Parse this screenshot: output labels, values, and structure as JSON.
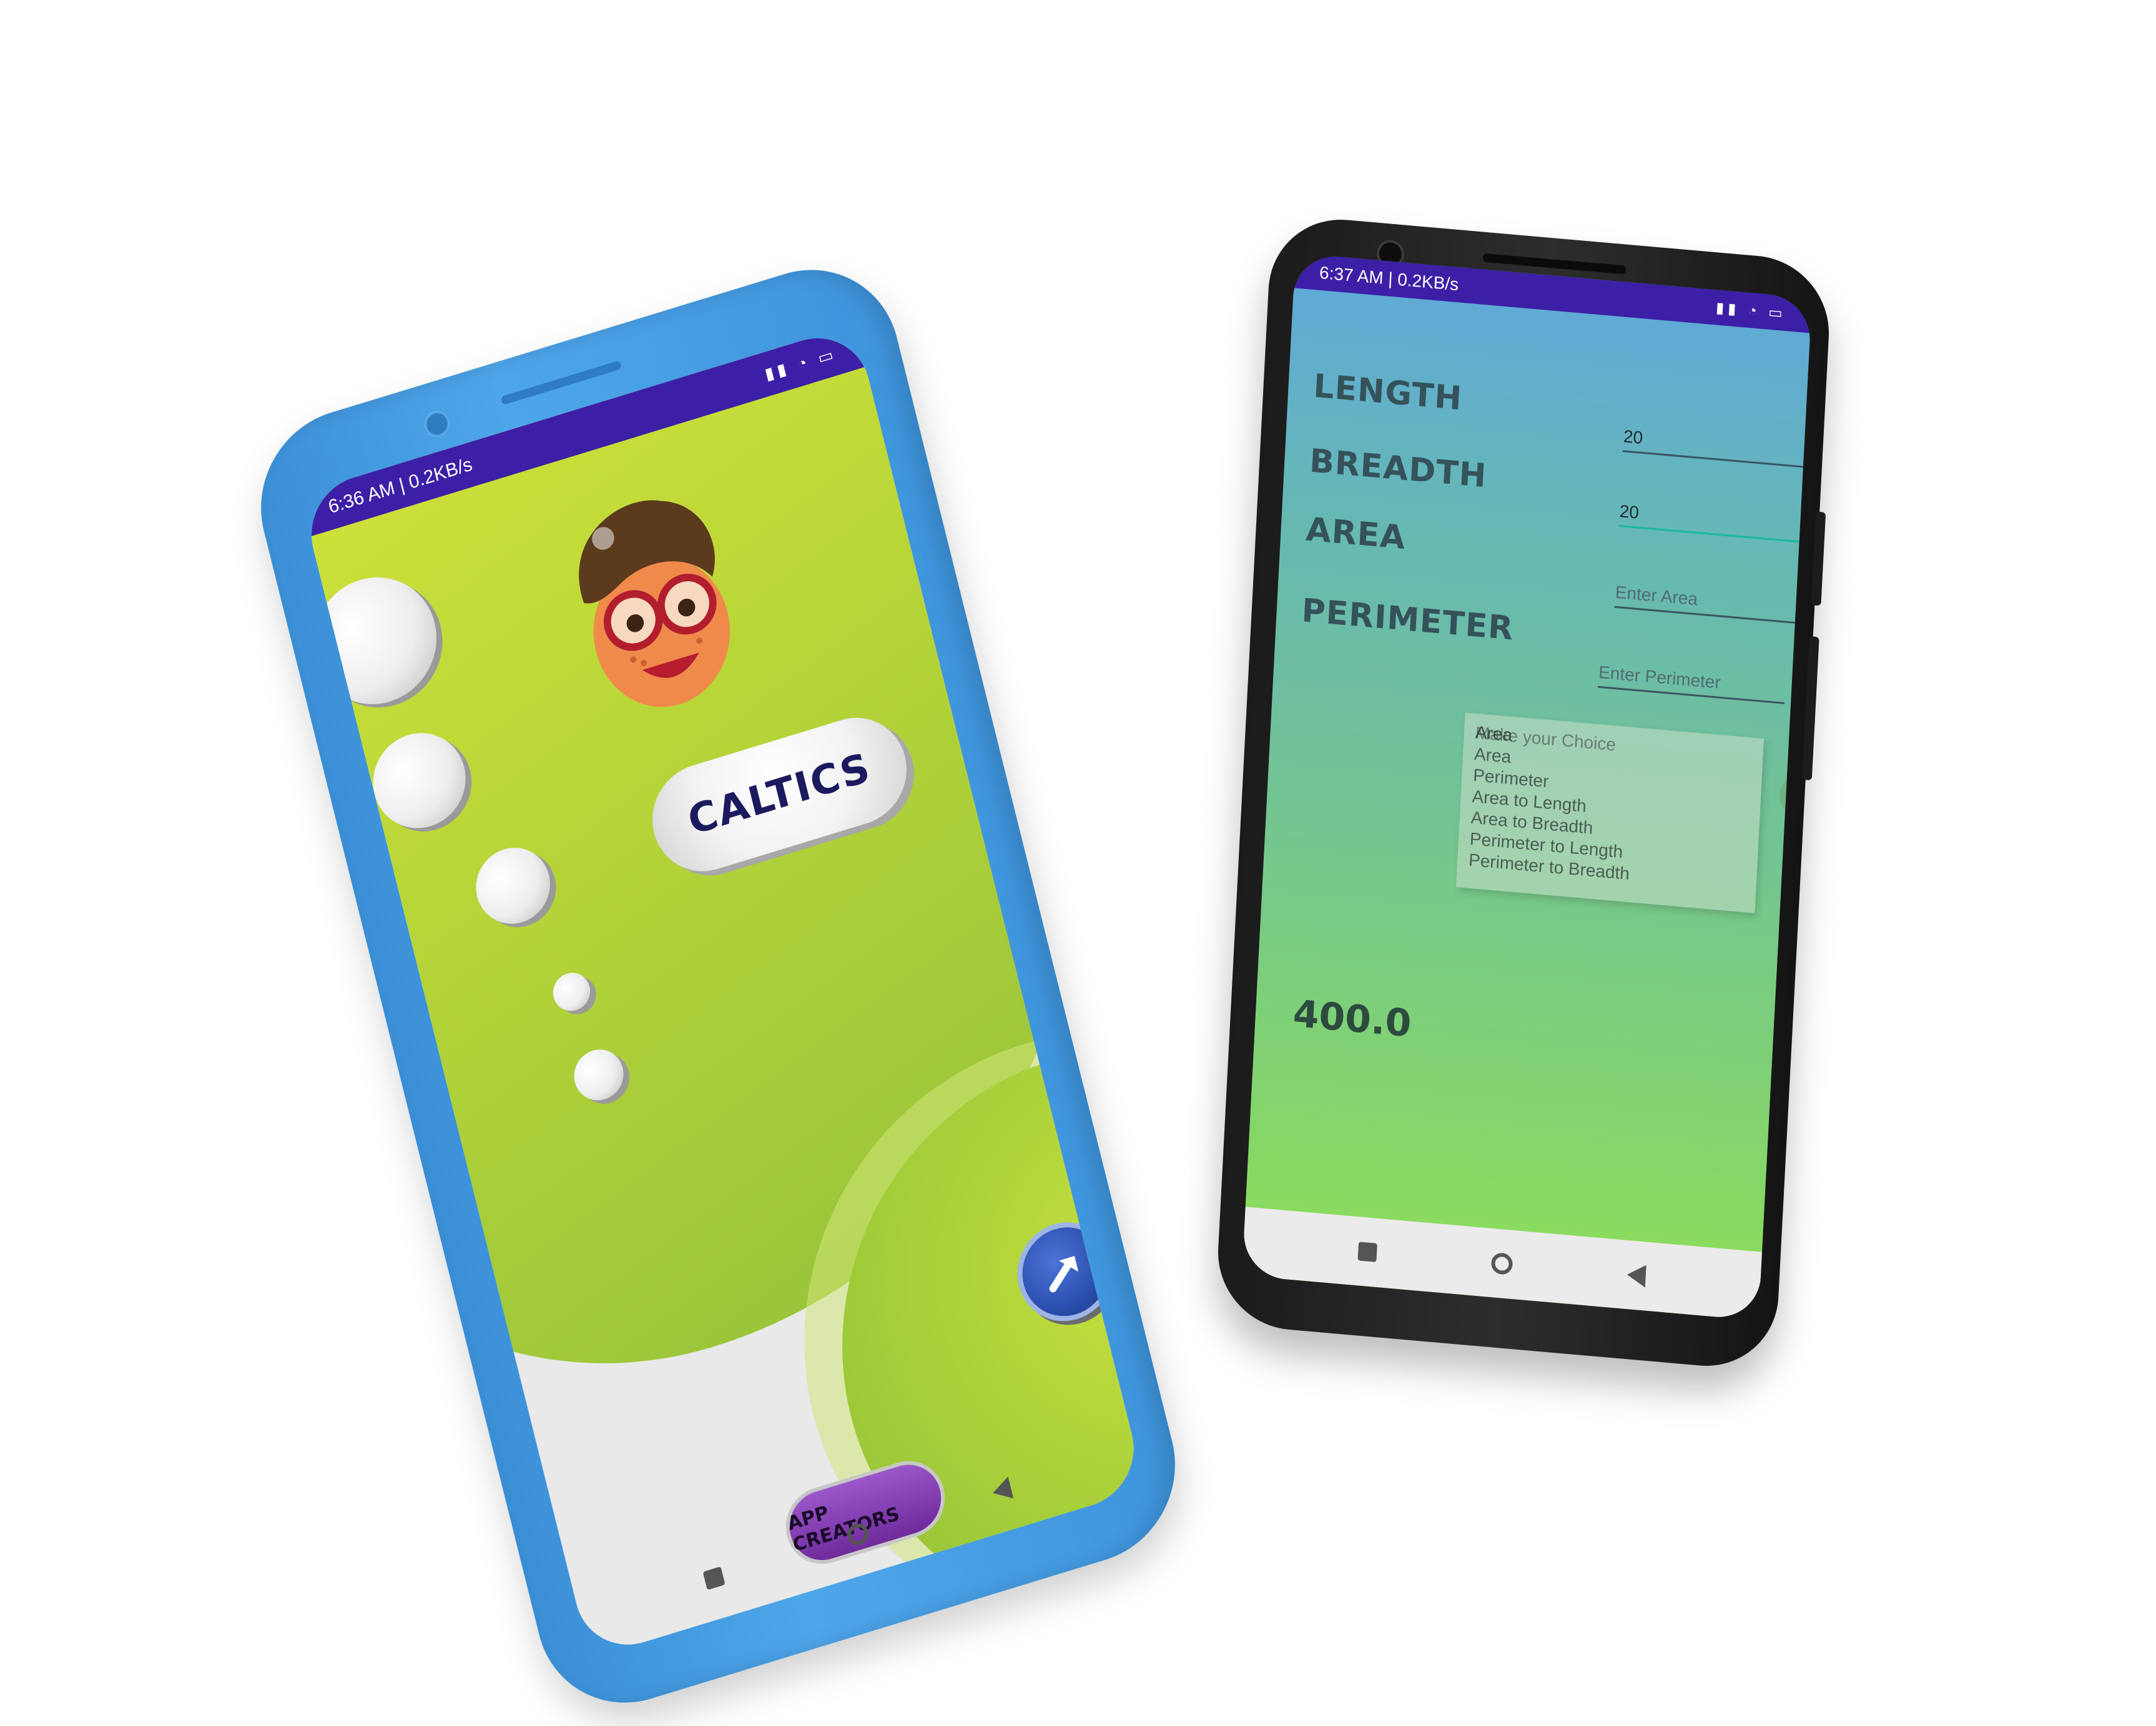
{
  "left_phone": {
    "status_bar": {
      "text": "6:36 AM | 0.2KB/s",
      "icons": "▮▮ ◔ ▭"
    },
    "app_title": "CALTICS",
    "app_creators_label": "APP CREATORS",
    "start_icon": "arrow-right-icon",
    "avatar_icon": "cartoon-avatar-icon"
  },
  "right_phone": {
    "status_bar": {
      "text": "6:37 AM | 0.2KB/s",
      "icons": "▮▮ ◔ ▭"
    },
    "labels": {
      "length": "LENGTH",
      "breadth": "BREADTH",
      "area": "AREA",
      "perimeter": "PERIMETER"
    },
    "fields": {
      "length_value": "20",
      "breadth_value": "20",
      "area_placeholder": "Enter Area",
      "perimeter_placeholder": "Enter Perimeter"
    },
    "dropdown": {
      "selected": "Area",
      "hint": "Make your Choice",
      "options": [
        "Area",
        "Perimeter",
        "Area to Length",
        "Area to Breadth",
        "Perimeter to Length",
        "Perimeter to Breadth"
      ]
    },
    "result": "400.0"
  },
  "colors": {
    "left_phone_body": "#4ea6ea",
    "right_phone_body": "#1b1b1b",
    "status_bar": "#3c1fa6",
    "lime": "#c8e03d",
    "title_text": "#1b1a5e"
  }
}
